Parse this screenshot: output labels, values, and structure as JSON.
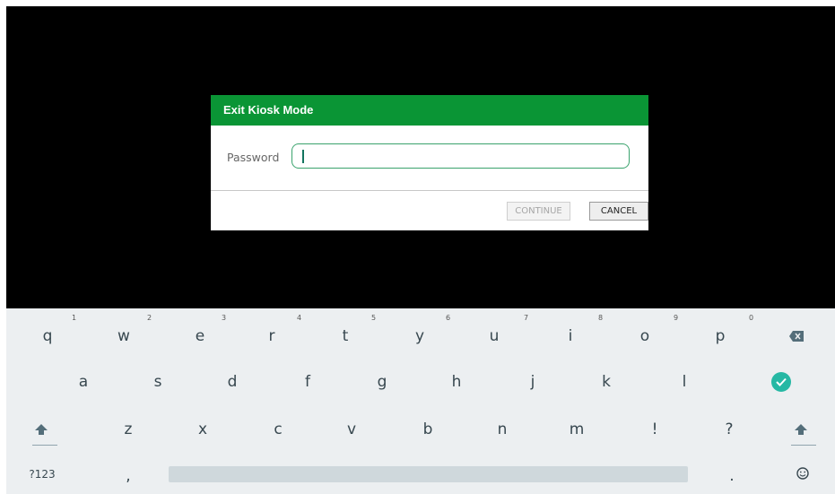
{
  "dialog": {
    "title": "Exit Kiosk Mode",
    "password_label": "Password",
    "password_value": "",
    "continue_label": "CONTINUE",
    "cancel_label": "CANCEL",
    "header_color": "#0a9535"
  },
  "keyboard": {
    "row1": [
      "q",
      "w",
      "e",
      "r",
      "t",
      "y",
      "u",
      "i",
      "o",
      "p"
    ],
    "row1_hints": [
      "1",
      "2",
      "3",
      "4",
      "5",
      "6",
      "7",
      "8",
      "9",
      "0"
    ],
    "row2": [
      "a",
      "s",
      "d",
      "f",
      "g",
      "h",
      "j",
      "k",
      "l"
    ],
    "row3": [
      "z",
      "x",
      "c",
      "v",
      "b",
      "n",
      "m",
      "!",
      "?"
    ],
    "symbols_label": "?123",
    "comma": ",",
    "period": ".",
    "icons": [
      "backspace-icon",
      "enter-check-icon",
      "shift-icon",
      "emoji-icon"
    ],
    "accent_color": "#26b8a4"
  }
}
